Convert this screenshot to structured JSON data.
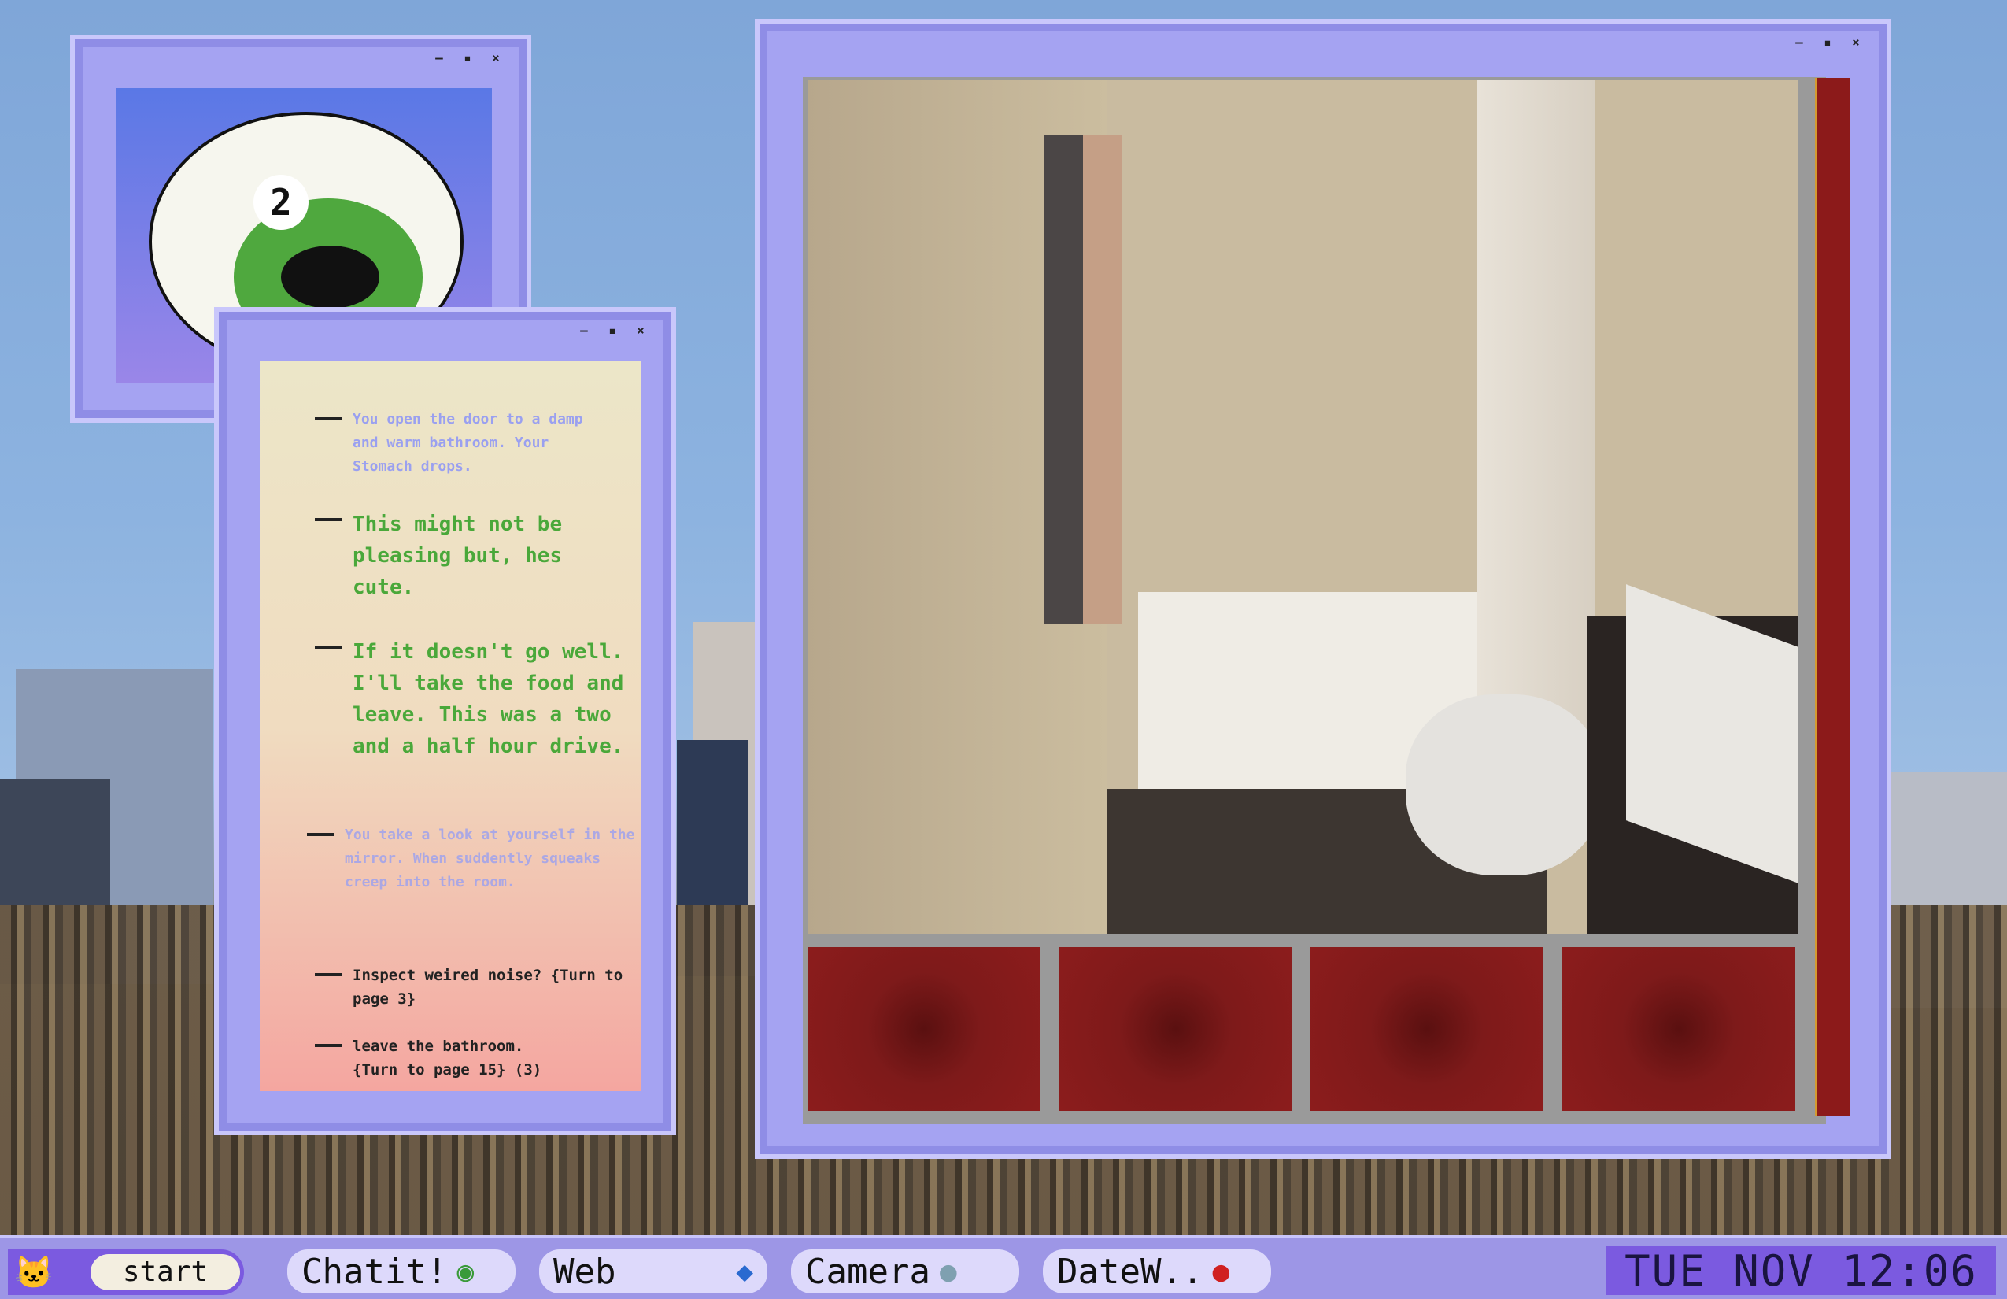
{
  "windows": {
    "eye": {
      "badge": "2"
    },
    "story": {
      "paragraphs": [
        "You open the door to a damp and warm bathroom. Your Stomach drops.",
        "This might not be pleasing but, hes cute.",
        "If it doesn't go well. I'll take the food and leave. This was a two and a half hour drive.",
        "You take a look at yourself in the mirror. When suddently squeaks creep into the room."
      ],
      "options": [
        "Inspect weired noise? {Turn to page 3}",
        "leave the bathroom. {Turn to page 15} (3)"
      ]
    },
    "controls": {
      "minimize": "–",
      "maximize": "▪",
      "close": "×"
    }
  },
  "taskbar": {
    "start": "start",
    "apps": [
      {
        "label": "Chatit!"
      },
      {
        "label": "Web"
      },
      {
        "label": "Camera"
      },
      {
        "label": "DateW.."
      }
    ],
    "clock": "TUE NOV 12:06"
  }
}
